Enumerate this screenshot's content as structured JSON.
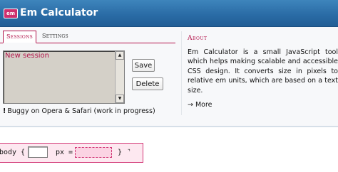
{
  "app": {
    "title": "Em Calculator",
    "icon_text": "em",
    "accent_color": "#b3144b",
    "titlebar_color": "#2a6ca6"
  },
  "tabs": [
    {
      "label": "Sessions",
      "active": true
    },
    {
      "label": "Settings",
      "active": false
    }
  ],
  "sessions": {
    "items": [
      "New session"
    ],
    "save_label": "Save",
    "delete_label": "Delete",
    "warning": "Buggy on Opera & Safari (work in progress)",
    "warning_icon": "!"
  },
  "about": {
    "heading": "About",
    "text": "Em Calculator is a small JavaScript tool which helps making scalable and accessible CSS design. It converts size in pixels to relative em units, which are based on a text size.",
    "more_label": "→ More"
  },
  "converter": {
    "selector": "body",
    "open_brace": "{",
    "px_label": "px =",
    "px_value": "",
    "em_value": "",
    "close_brace": "}",
    "resize_icon": "resize-handle-icon",
    "background_color": "#fde8f0",
    "border_color": "#d33a78"
  }
}
